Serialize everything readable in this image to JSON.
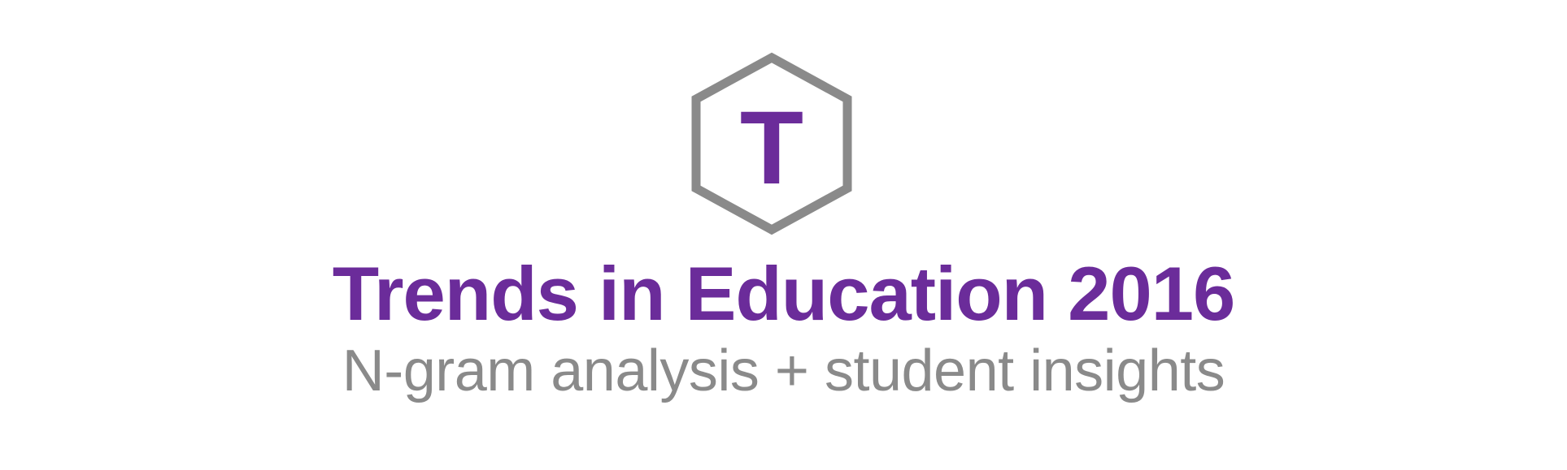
{
  "colors": {
    "brand_purple": "#6B2C9A",
    "hexagon_gray": "#8A8A8A",
    "subtitle_gray": "#8A8A8A",
    "background": "#FFFFFF"
  },
  "logo": {
    "icon": "hexagon-outline-icon",
    "letter": "T"
  },
  "title": "Trends in Education 2016",
  "subtitle": "N-gram analysis + student insights"
}
